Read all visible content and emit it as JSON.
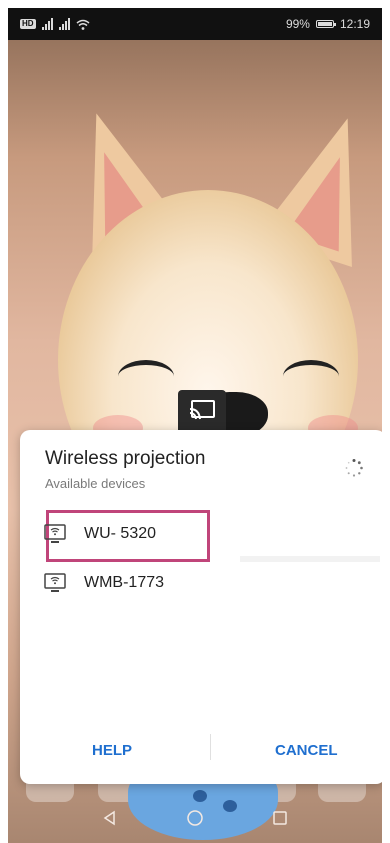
{
  "status_bar": {
    "left_badge": "HD",
    "battery_percent": "99%",
    "time": "12:19"
  },
  "dialog": {
    "title": "Wireless projection",
    "subtitle": "Available devices",
    "devices": [
      {
        "name": "WU- 5320",
        "icon": "tv-cast-icon",
        "highlighted": true
      },
      {
        "name": "WMB-1773",
        "icon": "tv-cast-icon",
        "highlighted": false
      }
    ],
    "help_label": "HELP",
    "cancel_label": "CANCEL",
    "accent_color": "#1f6fcf",
    "highlight_color": "#c0457a"
  },
  "navigation": {
    "back": "back-icon",
    "home": "home-icon",
    "recents": "recents-icon"
  }
}
